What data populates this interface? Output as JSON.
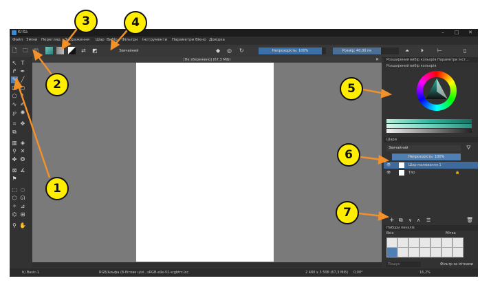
{
  "window": {
    "title": "Krita",
    "controls": [
      "–",
      "□",
      "✕"
    ]
  },
  "menu": [
    "Файл",
    "Зміни",
    "Перегляд",
    "Зображення",
    "Шар",
    "Вибір",
    "Фільтри",
    "Інструменти",
    "Параметри",
    "Вікно",
    "Довідка"
  ],
  "toolbar": {
    "preset_label": "Звичайний",
    "opacity_label": "Непрозорість: 100%",
    "size_label": "Розмір: 40,00 пк"
  },
  "canvas": {
    "title": "[Не збережено] (67,3 МіБ)",
    "close": "✕"
  },
  "dock": {
    "color_selector_tab1": "Розширений вибір кольорів",
    "color_selector_tab2": "Параметри інст...",
    "color_selector_title": "Розширений вибір кольорів",
    "layers_title": "Шари",
    "blend_mode": "Звичайний",
    "layer_opacity": "Непрозорість: 100%",
    "layers": [
      {
        "name": "Шар малювання 1"
      },
      {
        "name": "Тло"
      }
    ],
    "brush_title": "Набори пензлів",
    "brush_filter": "Всіх",
    "brush_tag_label": "Мітка",
    "brush_search_placeholder": "Пошук",
    "brush_checkbox_label": "Фільтр за мітками"
  },
  "status": {
    "brush": "b) Basic-1",
    "color_model": "RGB/Альфа (8-бітове цілі...sRGB-elle-V2-srgbtrc.icc",
    "size": "2 480 x 3 508 (67,3 МіБ)",
    "rotation": "0,00°",
    "zoom": "16,2%"
  },
  "callouts": [
    "1",
    "2",
    "3",
    "4",
    "5",
    "6",
    "7"
  ],
  "colors": {
    "arrow": "#f2902a",
    "callout_fill": "#ffee00",
    "accent": "#3a6fa8"
  }
}
